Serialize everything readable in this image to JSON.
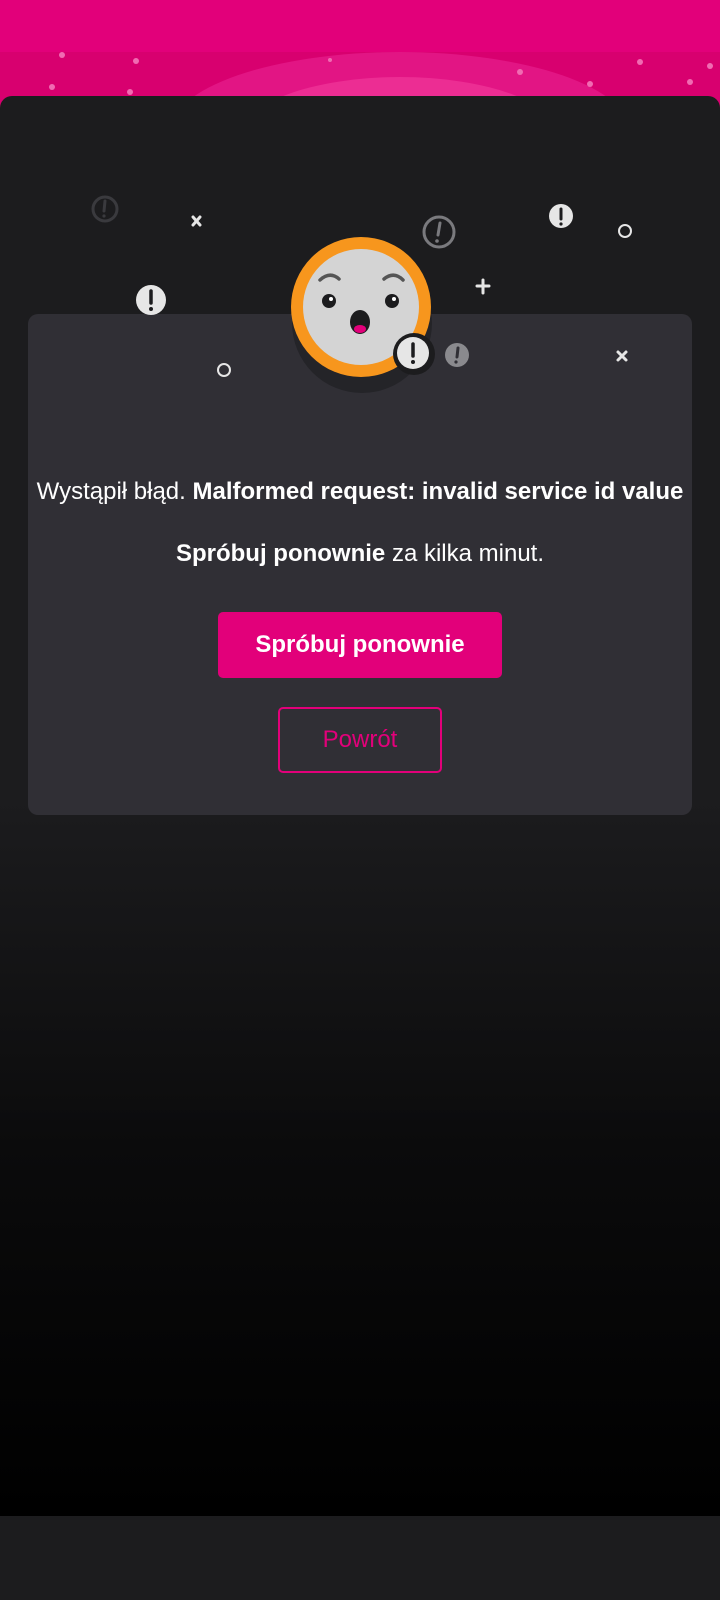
{
  "colors": {
    "brand": "#e2007a",
    "card_bg": "#302f35",
    "sheet_bg": "#1c1c1e",
    "face_ring": "#f7961d"
  },
  "icons": [
    "sad-face-icon",
    "exclamation-icon",
    "close-icon",
    "plus-icon",
    "circle-icon"
  ],
  "error": {
    "prefix": "Wystąpił błąd.",
    "detail": "Malformed request: invalid service id value"
  },
  "retry_hint": {
    "bold": "Spróbuj ponownie",
    "rest": "za kilka minut."
  },
  "buttons": {
    "retry_label": "Spróbuj ponownie",
    "back_label": "Powrót"
  }
}
